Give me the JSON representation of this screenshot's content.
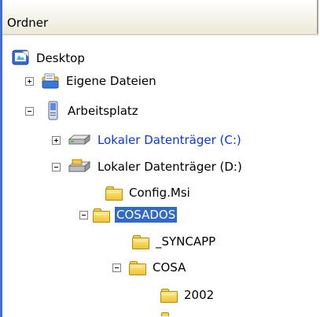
{
  "header": {
    "title": "Ordner"
  },
  "tree": {
    "desktop": "Desktop",
    "eigene_dateien": "Eigene Dateien",
    "arbeitsplatz": "Arbeitsplatz",
    "drive_c": "Lokaler Datenträger (C:)",
    "drive_d": "Lokaler Datenträger (D:)",
    "config_msi": "Config.Msi",
    "cosados": "COSADOS",
    "syncapp": "_SYNCAPP",
    "cosa": "COSA",
    "y2002": "2002"
  },
  "colors": {
    "selection": "#316ac5",
    "link_text": "#0b38d8",
    "accent": "#3d6fd6"
  }
}
